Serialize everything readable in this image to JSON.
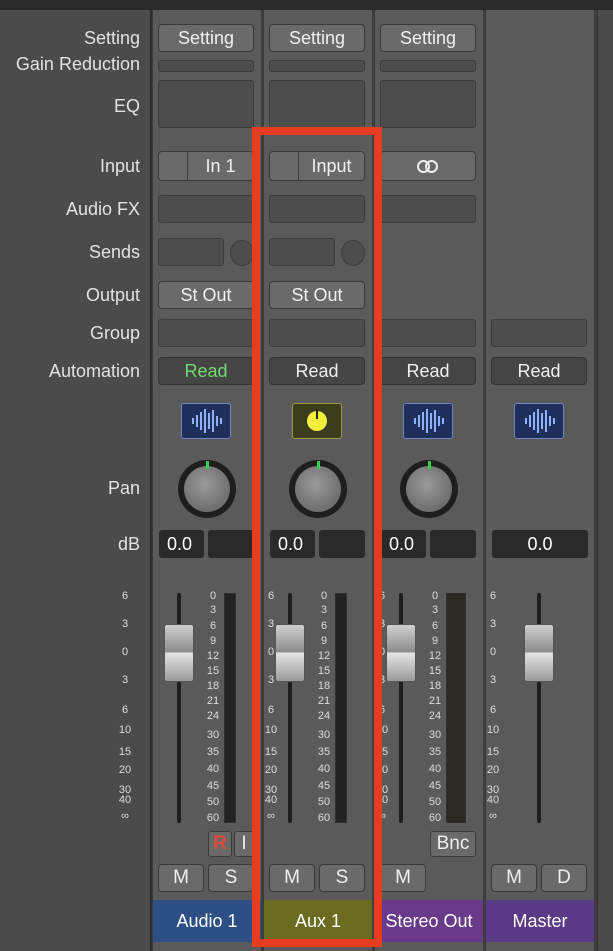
{
  "row_labels": {
    "setting": "Setting",
    "gain_reduction": "Gain Reduction",
    "eq": "EQ",
    "input": "Input",
    "audio_fx": "Audio FX",
    "sends": "Sends",
    "output": "Output",
    "group": "Group",
    "automation": "Automation",
    "pan": "Pan",
    "db": "dB"
  },
  "left_scale": [
    "6",
    "3",
    "0",
    "3",
    "6",
    "10",
    "15",
    "20",
    "30",
    "40",
    "∞"
  ],
  "meter_scale": [
    "0",
    "3",
    "6",
    "9",
    "12",
    "15",
    "18",
    "21",
    "24",
    "30",
    "35",
    "40",
    "45",
    "50",
    "60"
  ],
  "strips": {
    "audio1": {
      "setting": "Setting",
      "input": "In 1",
      "output": "St Out",
      "automation": "Read",
      "db": "0.0",
      "rec": "R",
      "input_mon": "I",
      "mute": "M",
      "solo": "S",
      "name": "Audio 1"
    },
    "aux1": {
      "setting": "Setting",
      "input": "Input",
      "output": "St Out",
      "automation": "Read",
      "db": "0.0",
      "mute": "M",
      "solo": "S",
      "name": "Aux 1"
    },
    "stereo_out": {
      "setting": "Setting",
      "automation": "Read",
      "db": "0.0",
      "bounce": "Bnc",
      "mute": "M",
      "name": "Stereo Out"
    },
    "master": {
      "automation": "Read",
      "db": "0.0",
      "mute": "M",
      "dim": "D",
      "name": "Master"
    }
  },
  "colors": {
    "audio1_name_bg": "#2d4f86",
    "aux1_name_bg": "#6b6b22",
    "stereo_out_name_bg": "#6a3a8a",
    "master_name_bg": "#5a3a86",
    "highlight": "#e63c22",
    "read_green": "#6fdc6f"
  }
}
